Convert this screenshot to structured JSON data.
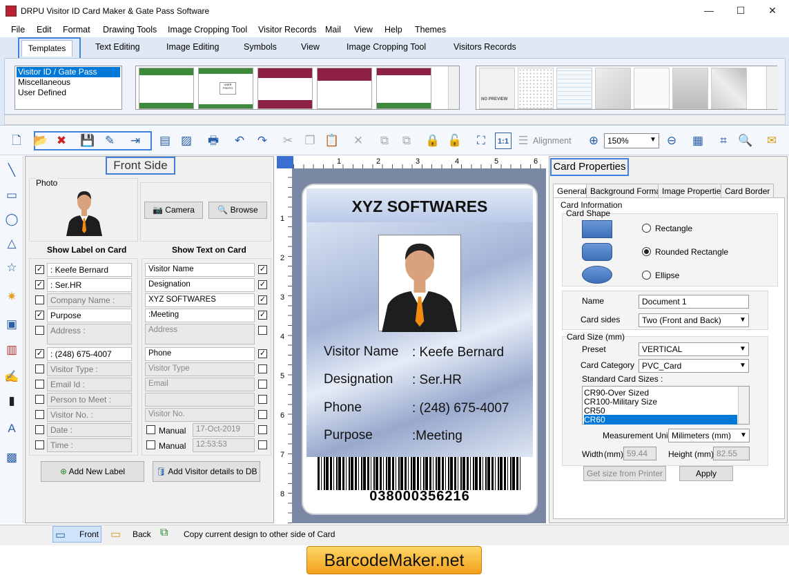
{
  "window": {
    "title": "DRPU Visitor ID Card Maker & Gate Pass Software",
    "minimize": "—",
    "maximize": "☐",
    "close": "✕"
  },
  "menu": [
    "File",
    "Edit",
    "Format",
    "Drawing Tools",
    "Image Cropping Tool",
    "Visitor Records",
    "Mail",
    "View",
    "Help",
    "Themes"
  ],
  "ribbon_tabs": [
    "Templates",
    "Text Editing",
    "Image Editing",
    "Symbols",
    "View",
    "Image Cropping Tool",
    "Visitors Records"
  ],
  "template_categories": [
    "Visitor ID / Gate Pass",
    "Miscellaneous",
    "User Defined"
  ],
  "template_thumb_text": "USER PHOTO",
  "no_preview": "NO PREVIEW",
  "toolbar": {
    "alignment": "Alignment",
    "zoom": "150%",
    "fit_label": "1:1"
  },
  "front": {
    "title": "Front Side",
    "photo_label": "Photo",
    "camera": "Camera",
    "browse": "Browse",
    "show_label_header": "Show Label on Card",
    "show_text_header": "Show Text on Card",
    "rows": [
      {
        "label_checked": true,
        "label": ": Keefe Bernard",
        "text": "Visitor Name",
        "text_checked": true,
        "enabled": true
      },
      {
        "label_checked": true,
        "label": ": Ser.HR",
        "text": "Designation",
        "text_checked": true,
        "enabled": true
      },
      {
        "label_checked": false,
        "label": "Company Name :",
        "text": "XYZ SOFTWARES",
        "text_checked": true,
        "enabled": false,
        "text_enabled": true
      },
      {
        "label_checked": true,
        "label": "Purpose",
        "text": ":Meeting",
        "text_checked": true,
        "enabled": true
      },
      {
        "label_checked": false,
        "label": "Address :",
        "text": "Address",
        "text_checked": false,
        "enabled": false
      },
      {
        "label_checked": true,
        "label": ": (248) 675-4007",
        "text": "Phone",
        "text_checked": true,
        "enabled": true
      },
      {
        "label_checked": false,
        "label": "Visitor Type :",
        "text": "Visitor Type",
        "text_checked": false,
        "enabled": false
      },
      {
        "label_checked": false,
        "label": "Email Id :",
        "text": "Email",
        "text_checked": false,
        "enabled": false
      },
      {
        "label_checked": false,
        "label": "Person to Meet :",
        "text": "",
        "text_checked": false,
        "enabled": false
      },
      {
        "label_checked": false,
        "label": "Visitor No. :",
        "text": "Visitor No.",
        "text_checked": false,
        "enabled": false
      },
      {
        "label_checked": false,
        "label": "Date :",
        "text": "17-Oct-2019",
        "manual": "Manual",
        "text_checked": false,
        "enabled": false
      },
      {
        "label_checked": false,
        "label": "Time :",
        "text": "12:53:53",
        "manual": "Manual",
        "text_checked": false,
        "enabled": false
      }
    ],
    "add_label": "Add New Label",
    "add_db": "Add Visitor details to DB"
  },
  "ruler": {
    "top": [
      "1",
      "2",
      "3",
      "4",
      "5",
      "6"
    ],
    "left": [
      "1",
      "2",
      "3",
      "4",
      "5",
      "6",
      "7",
      "8"
    ]
  },
  "card": {
    "company": "XYZ SOFTWARES",
    "fields": [
      {
        "label": "Visitor Name",
        "value": ": Keefe Bernard"
      },
      {
        "label": "Designation",
        "value": ": Ser.HR"
      },
      {
        "label": "Phone",
        "value": ": (248) 675-4007"
      },
      {
        "label": "Purpose",
        "value": ":Meeting"
      }
    ],
    "barcode_number": "038000356216"
  },
  "props": {
    "title": "Card Properties",
    "tabs": [
      "General",
      "Background Format",
      "Image Properties",
      "Card Border"
    ],
    "card_information": "Card Information",
    "card_shape": "Card Shape",
    "shapes": [
      "Rectangle",
      "Rounded Rectangle",
      "Ellipse"
    ],
    "selected_shape": 1,
    "name_label": "Name",
    "name_value": "Document 1",
    "sides_label": "Card sides",
    "sides_value": "Two (Front and Back)",
    "size_section": "Card Size (mm)",
    "preset_label": "Preset",
    "preset_value": "VERTICAL",
    "category_label": "Card Category",
    "category_value": "PVC_Card",
    "std_sizes_label": "Standard Card Sizes :",
    "std_sizes": [
      "CR90-Over Sized",
      "CR100-Military Size",
      "CR50",
      "CR60"
    ],
    "std_selected": 3,
    "unit_label": "Measurement Unit :",
    "unit_value": "Milimeters (mm)",
    "width_label": "Width",
    "height_label": "Height",
    "mm": "(mm)",
    "width_value": "59.44",
    "height_value": "82.55",
    "printer_button": "Get size from Printer",
    "apply_button": "Apply"
  },
  "status": {
    "front": "Front",
    "back": "Back",
    "copy": "Copy current design to other side of Card"
  },
  "banner": "BarcodeMaker.net",
  "colors": {
    "accent_highlight": "#3f7fe0",
    "ribbon": "#dfe8f5",
    "banner": "#f4a01b",
    "selection": "#0078d7"
  }
}
